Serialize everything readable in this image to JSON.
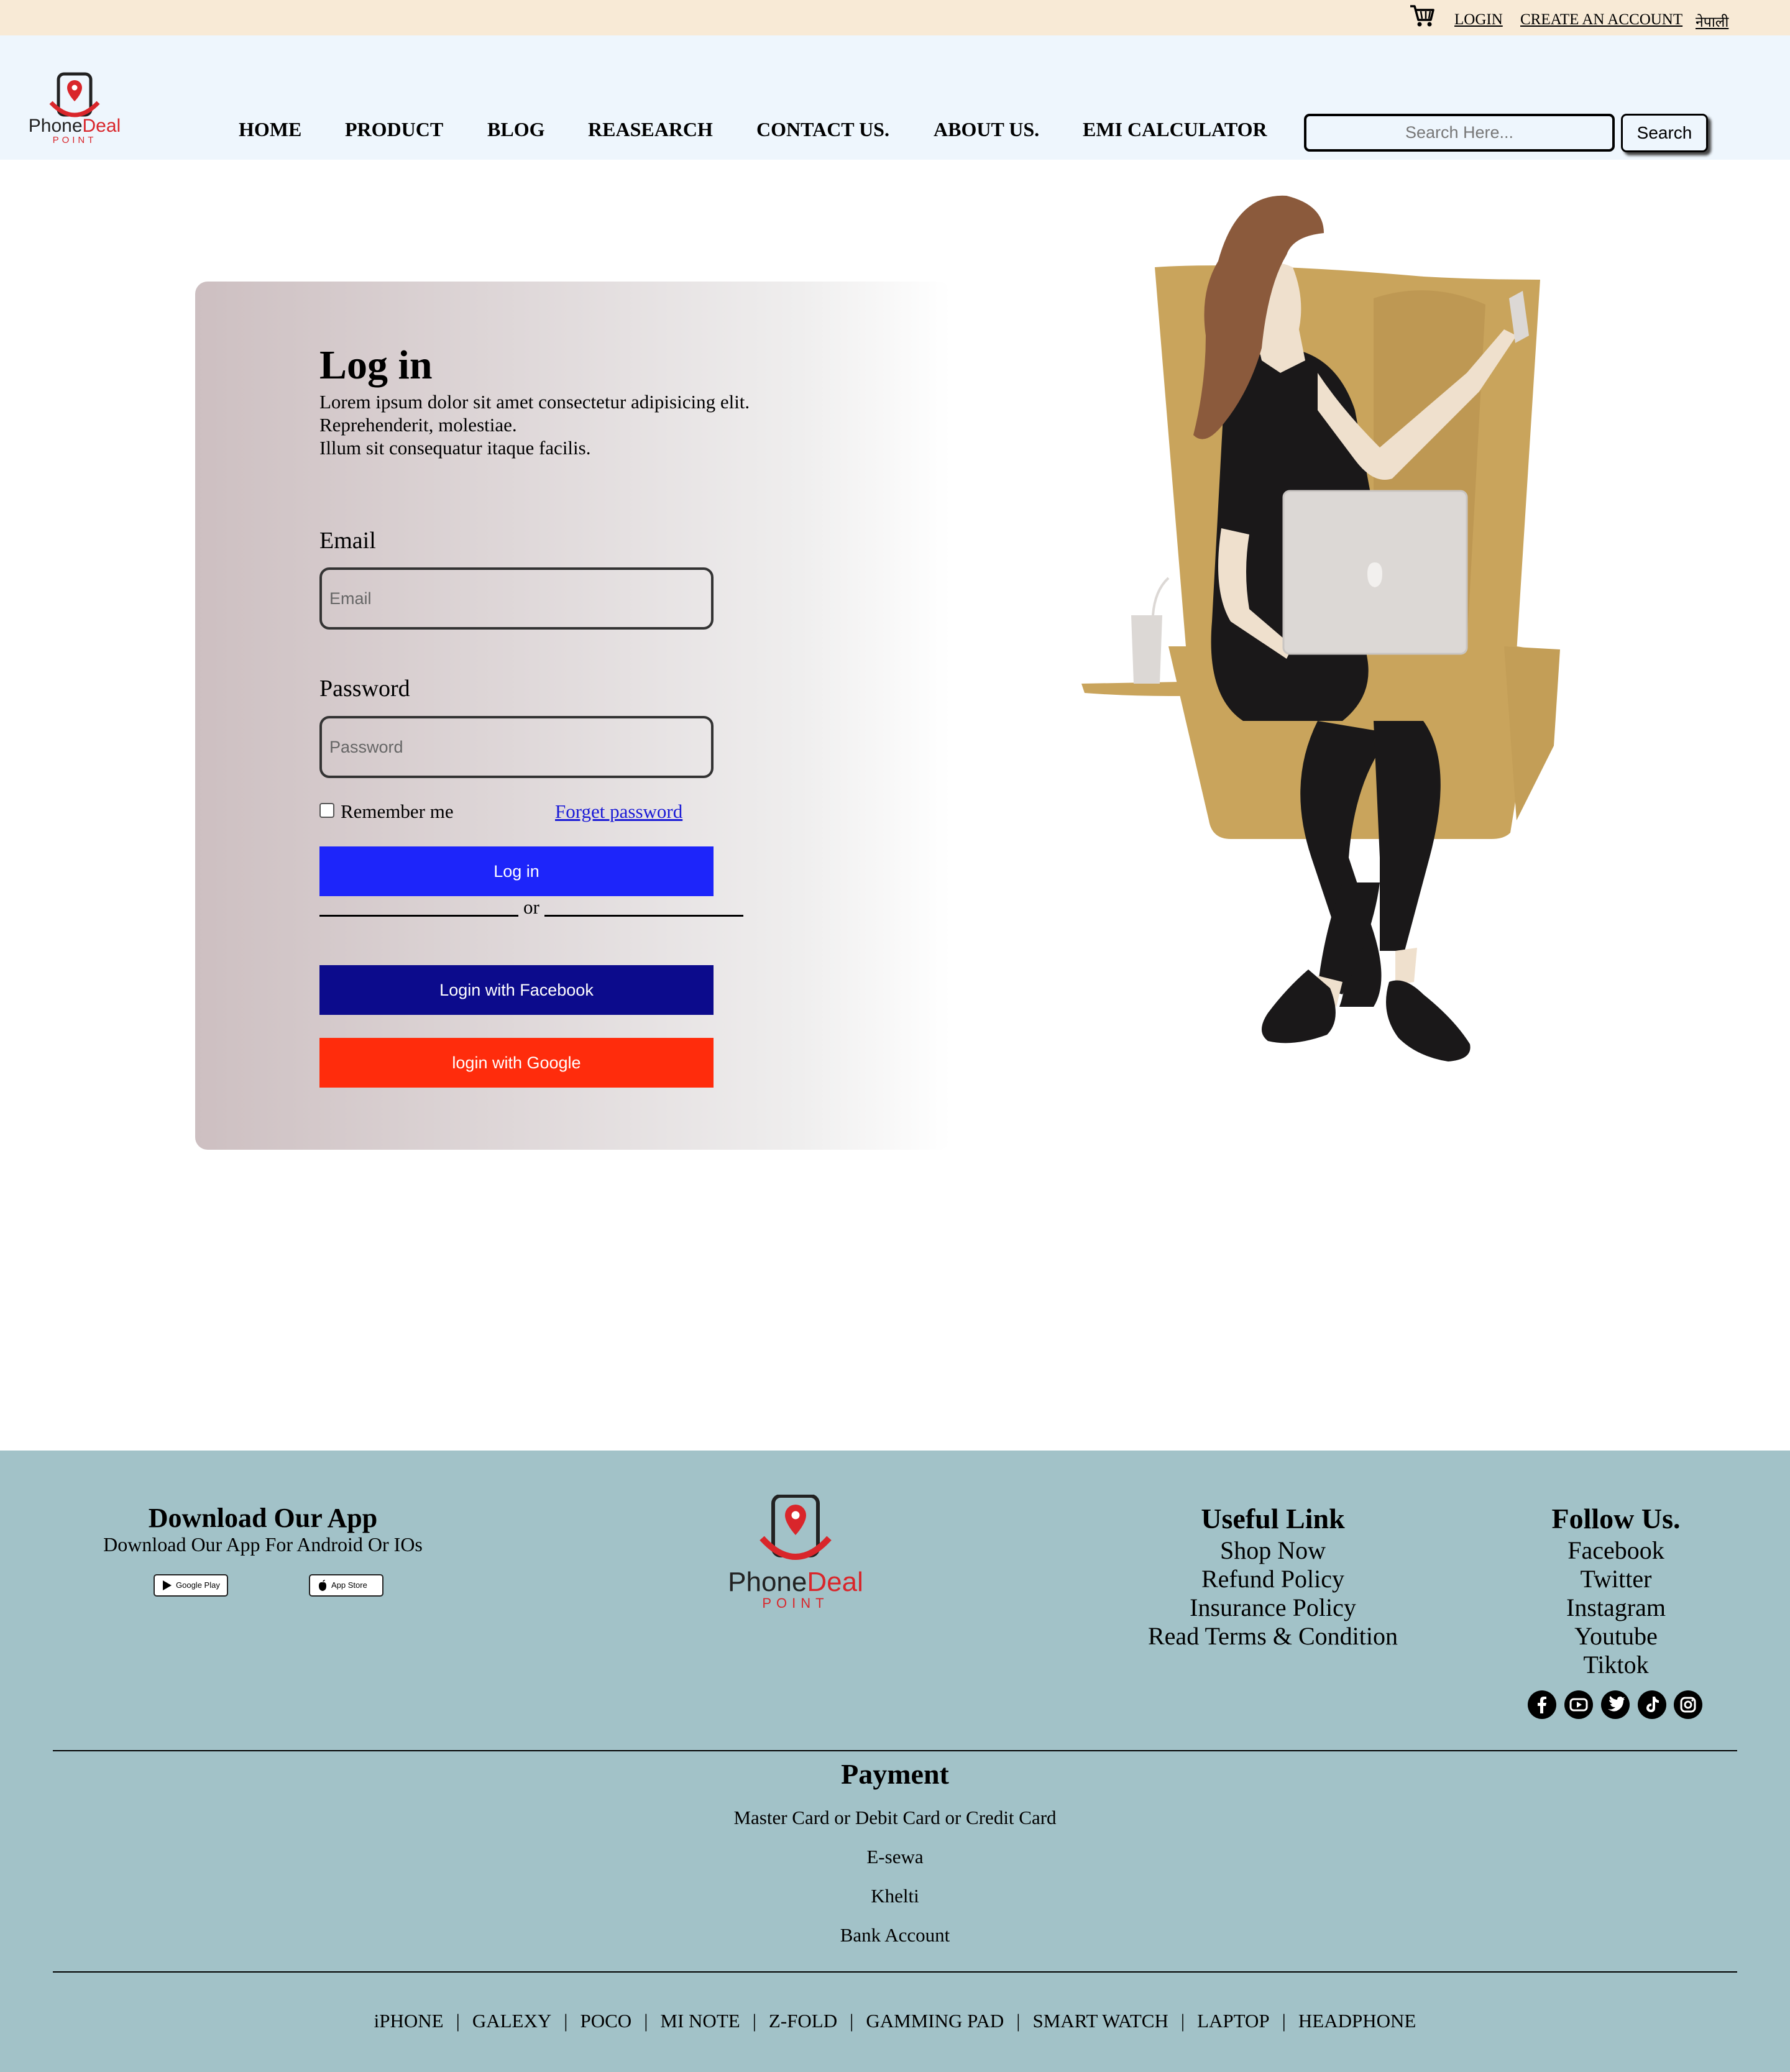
{
  "topbar": {
    "cart_icon": "shopping-cart-icon",
    "login": "LOGIN",
    "create_account": "CREATE AN ACCOUNT",
    "language": "नेपाली"
  },
  "header": {
    "logo_main": "Phone",
    "logo_accent": "Deal",
    "logo_sub": "POINT",
    "nav": [
      "HOME",
      "PRODUCT",
      "BLOG",
      "REASEARCH",
      "CONTACT US.",
      "ABOUT US.",
      "EMI CALCULATOR"
    ],
    "search_placeholder": "Search Here...",
    "search_button": "Search"
  },
  "login": {
    "title": "Log in",
    "description": [
      "Lorem ipsum dolor sit amet consectetur adipisicing elit.",
      "Reprehenderit, molestiae.",
      "Illum sit consequatur itaque facilis."
    ],
    "email_label": "Email",
    "email_placeholder": "Email",
    "password_label": "Password",
    "password_placeholder": "Password",
    "remember_me": "Remember me",
    "remember_checked": false,
    "forget_password": "Forget password",
    "login_button": "Log in",
    "or": "or",
    "facebook_button": "Login with Facebook",
    "google_button": "login with Google"
  },
  "footer": {
    "download": {
      "title": "Download Our App",
      "subtitle": "Download Our App For Android Or IOs",
      "google_play": "Google Play",
      "app_store": "App Store"
    },
    "logo_main": "Phone",
    "logo_accent": "Deal",
    "logo_sub": "POINT",
    "useful_links": {
      "title": "Useful Link",
      "items": [
        "Shop Now",
        "Refund Policy",
        "Insurance Policy",
        "Read Terms & Condition"
      ]
    },
    "follow": {
      "title": "Follow Us.",
      "items": [
        "Facebook",
        "Twitter",
        "Instagram",
        "Youtube",
        "Tiktok"
      ],
      "icons": [
        "facebook-icon",
        "youtube-icon",
        "twitter-icon",
        "tiktok-icon",
        "instagram-icon"
      ]
    },
    "payment": {
      "title": "Payment",
      "items": [
        "Master Card or Debit Card or Credit Card",
        "E-sewa",
        "Khelti",
        "Bank Account"
      ]
    },
    "bottom_nav": [
      "iPHONE",
      "GALEXY",
      "POCO",
      "MI NOTE",
      "Z-FOLD",
      "GAMMING PAD",
      "SMART WATCH",
      "LAPTOP",
      "HEADPHONE"
    ],
    "separator": "|"
  },
  "colors": {
    "topbar_bg": "#f8ead6",
    "header_bg": "#eef6fd",
    "footer_bg": "#a2c2c8",
    "login_button": "#1d25fa",
    "facebook_button": "#0c0b8c",
    "google_button": "#ff2c0c",
    "brand_red": "#d9262b",
    "chair": "#c9a45c"
  }
}
